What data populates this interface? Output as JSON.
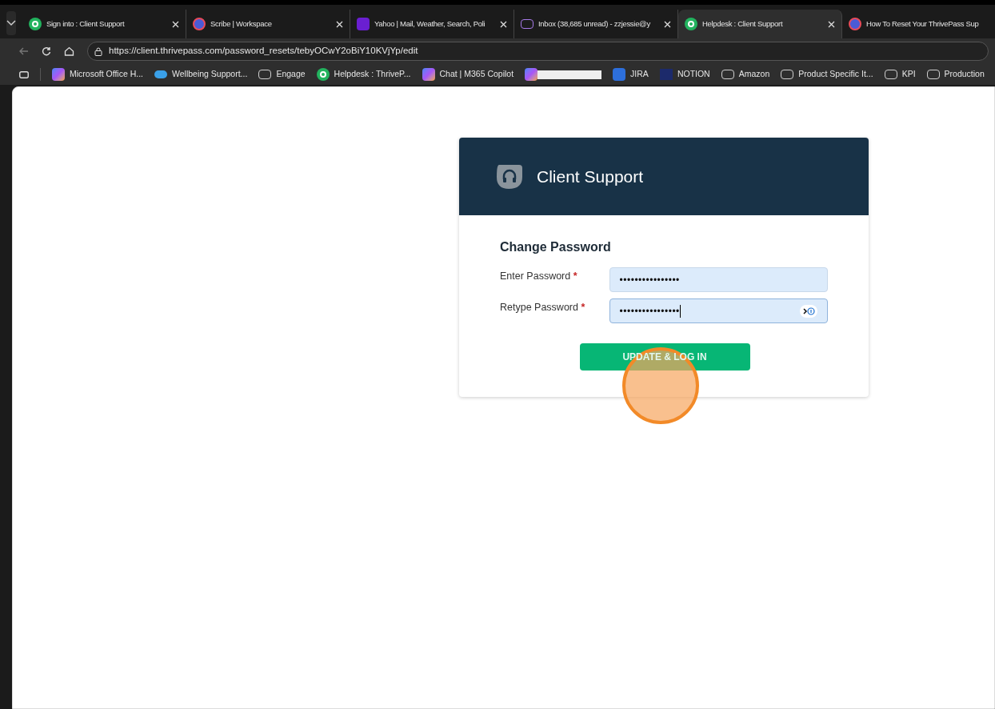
{
  "tabs": [
    {
      "title": "Sign into : Client Support",
      "kind": "helpdesk",
      "selected": false,
      "closable": true
    },
    {
      "title": "Scribe | Workspace",
      "kind": "scribe",
      "selected": false,
      "closable": true
    },
    {
      "title": "Yahoo | Mail, Weather, Search, Poli",
      "kind": "yahoo",
      "selected": false,
      "closable": true
    },
    {
      "title": "Inbox (38,685 unread) - zzjessie@y",
      "kind": "mail",
      "selected": false,
      "closable": true
    },
    {
      "title": "Helpdesk : Client Support",
      "kind": "helpdesk",
      "selected": true,
      "closable": true
    },
    {
      "title": "How To Reset Your ThrivePass Sup",
      "kind": "scribe",
      "selected": false,
      "closable": false
    }
  ],
  "address": "https://client.thrivepass.com/password_resets/tebyOCwY2oBiY10KVjYp/edit",
  "bookmarks": [
    {
      "label": "Microsoft Office H...",
      "kind": "copilot"
    },
    {
      "label": "Wellbeing Support...",
      "kind": "cloud"
    },
    {
      "label": "Engage",
      "kind": "folder"
    },
    {
      "label": "Helpdesk : ThriveP...",
      "kind": "helpdesk"
    },
    {
      "label": "Chat | M365 Copilot",
      "kind": "copilot"
    },
    {
      "kind": "redacted"
    },
    {
      "label": "JIRA",
      "kind": "jira"
    },
    {
      "label": "NOTION",
      "kind": "notion"
    },
    {
      "label": "Amazon",
      "kind": "folder"
    },
    {
      "label": "Product Specific It...",
      "kind": "folder"
    },
    {
      "label": "KPI",
      "kind": "folder"
    },
    {
      "label": "Production",
      "kind": "folder"
    }
  ],
  "card": {
    "title": "Client Support",
    "heading": "Change Password",
    "fields": [
      {
        "label": "Enter Password",
        "required": "*",
        "value": "••••••••••••••••",
        "focused": false
      },
      {
        "label": "Retype Password",
        "required": "*",
        "value": "••••••••••••••••",
        "focused": true
      }
    ],
    "button": "UPDATE & LOG IN"
  },
  "click_marker": {
    "shown": true
  }
}
